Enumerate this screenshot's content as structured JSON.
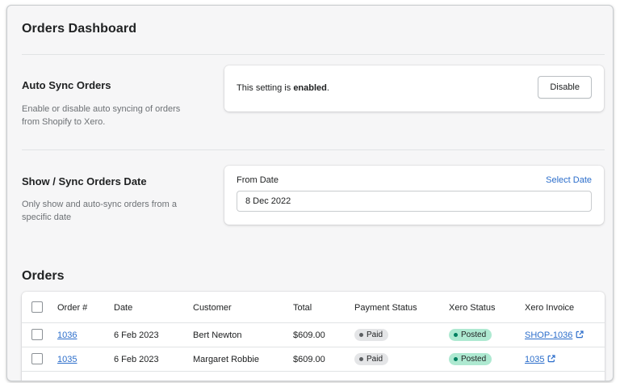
{
  "page": {
    "title": "Orders Dashboard"
  },
  "auto_sync": {
    "title": "Auto Sync Orders",
    "description": "Enable or disable auto syncing of orders from Shopify to Xero.",
    "status_prefix": "This setting is ",
    "status_value": "enabled",
    "status_suffix": ".",
    "button_label": "Disable"
  },
  "sync_date": {
    "title": "Show / Sync Orders Date",
    "description": "Only show and auto-sync orders from a specific date",
    "field_label": "From Date",
    "action_label": "Select Date",
    "value": "8 Dec 2022"
  },
  "orders": {
    "heading": "Orders",
    "columns": {
      "order": "Order #",
      "date": "Date",
      "customer": "Customer",
      "total": "Total",
      "payment_status": "Payment Status",
      "xero_status": "Xero Status",
      "xero_invoice": "Xero Invoice"
    },
    "rows": [
      {
        "order": "1036",
        "date": "6 Feb 2023",
        "customer": "Bert Newton",
        "total": "$609.00",
        "payment_status": "Paid",
        "xero_status": "Posted",
        "xero_invoice": "SHOP-1036"
      },
      {
        "order": "1035",
        "date": "6 Feb 2023",
        "customer": "Margaret Robbie",
        "total": "$609.00",
        "payment_status": "Paid",
        "xero_status": "Posted",
        "xero_invoice": "1035"
      }
    ]
  },
  "icons": {
    "invoice_link": "external-link-icon"
  },
  "colors": {
    "link": "#2c6ecb",
    "posted_badge": "#aee9d1",
    "paid_badge": "#e4e5e7",
    "background": "#f6f6f7"
  }
}
